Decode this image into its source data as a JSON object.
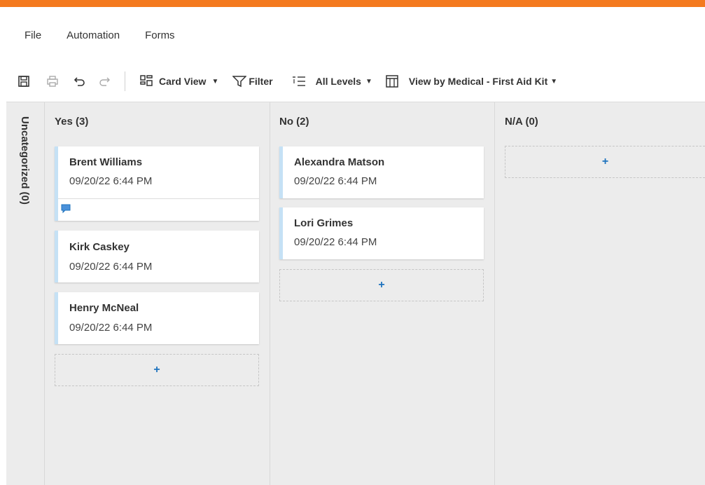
{
  "menu": {
    "items": [
      "File",
      "Automation",
      "Forms"
    ]
  },
  "toolbar": {
    "card_view_label": "Card View",
    "filter_label": "Filter",
    "levels_label": "All Levels",
    "view_by_label": "View by Medical - First Aid Kit"
  },
  "board": {
    "uncategorized_label": "Uncategorized (0)",
    "columns": [
      {
        "title": "Yes (3)",
        "cards": [
          {
            "name": "Brent Williams",
            "time": "09/20/22 6:44 PM",
            "has_comment": true
          },
          {
            "name": "Kirk Caskey",
            "time": "09/20/22 6:44 PM"
          },
          {
            "name": "Henry McNeal",
            "time": "09/20/22 6:44 PM"
          }
        ],
        "add_label": "+"
      },
      {
        "title": "No (2)",
        "cards": [
          {
            "name": "Alexandra Matson",
            "time": "09/20/22 6:44 PM"
          },
          {
            "name": "Lori Grimes",
            "time": "09/20/22 6:44 PM"
          }
        ],
        "add_label": "+"
      },
      {
        "title": "N/A (0)",
        "cards": [],
        "add_label": "+"
      }
    ]
  },
  "colors": {
    "accent": "#f47a1f",
    "card_stripe": "#c5e1f5",
    "link_blue": "#1e73be"
  }
}
